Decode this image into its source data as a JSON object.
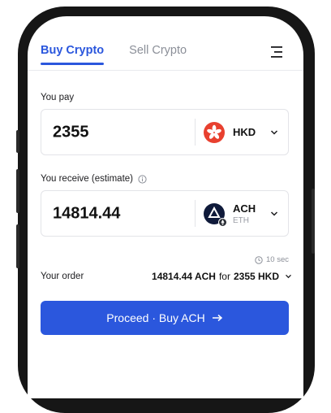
{
  "tabs": [
    {
      "label": "Buy Crypto",
      "active": true
    },
    {
      "label": "Sell Crypto",
      "active": false
    }
  ],
  "pay": {
    "label": "You pay",
    "amount": "2355",
    "currency": {
      "code": "HKD",
      "icon": "hong-kong-flag-icon",
      "color": "#e8402f"
    }
  },
  "receive": {
    "label": "You receive (estimate)",
    "info_icon": "info-icon",
    "amount": "14814.44",
    "currency": {
      "code": "ACH",
      "network": "ETH",
      "icon": "alchemy-pay-icon",
      "color": "#0f1a3a"
    }
  },
  "timer": {
    "text": "10 sec",
    "icon": "clock-icon"
  },
  "order": {
    "label": "Your order",
    "receive_value": "14814.44 ACH",
    "connector": "for",
    "pay_value": "2355 HKD"
  },
  "cta": {
    "label": "Proceed · Buy ACH",
    "icon": "arrow-right-icon",
    "color": "#2b57dd"
  }
}
